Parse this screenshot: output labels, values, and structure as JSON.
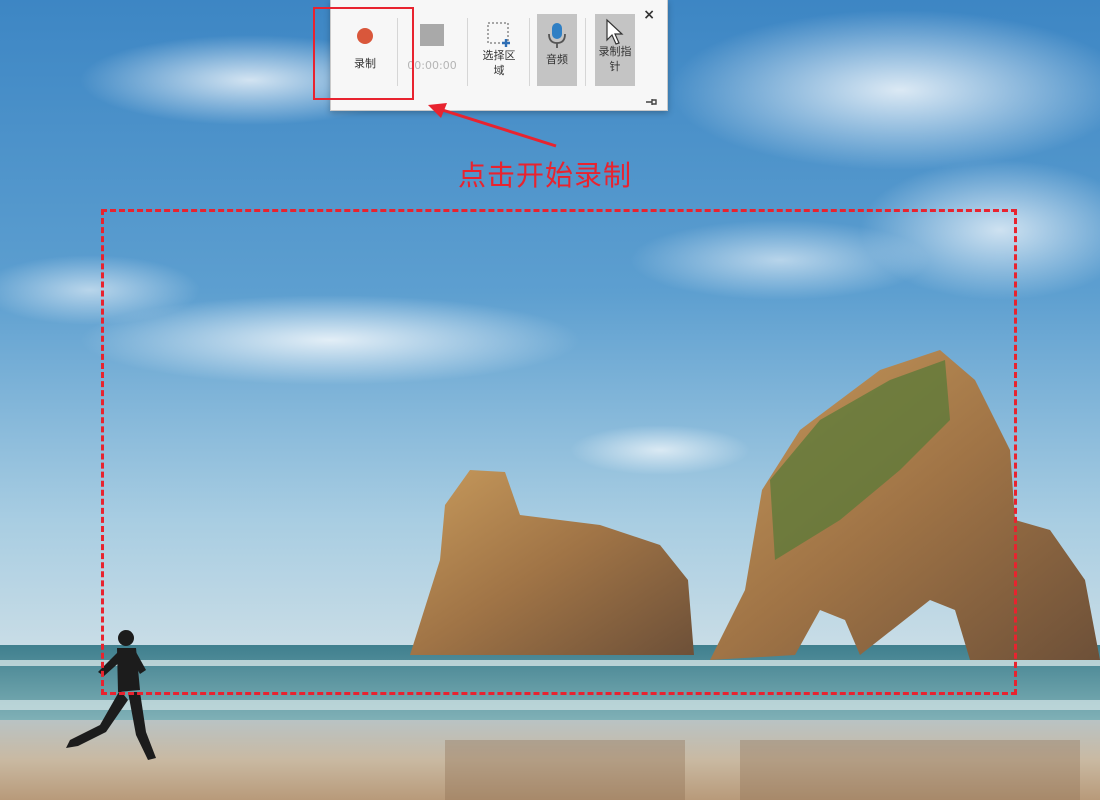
{
  "toolbar": {
    "record_label": "录制",
    "timer_label": "00:00:00",
    "select_area_label": "选择区域",
    "audio_label": "音频",
    "record_pointer_label": "录制指针",
    "close_label": "×"
  },
  "annotation": {
    "callout_text": "点击开始录制"
  },
  "colors": {
    "record_dot": "#d9573b",
    "annotation_red": "#e8232f",
    "toolbar_bg": "#f7f7f7",
    "toggle_active_bg": "#c4c4c4"
  },
  "icons": {
    "record": "record-dot-icon",
    "stop": "stop-square-icon",
    "select_area": "dashed-area-plus-icon",
    "audio": "microphone-icon",
    "pointer": "cursor-arrow-icon",
    "close": "close-icon",
    "pin": "pin-icon"
  }
}
